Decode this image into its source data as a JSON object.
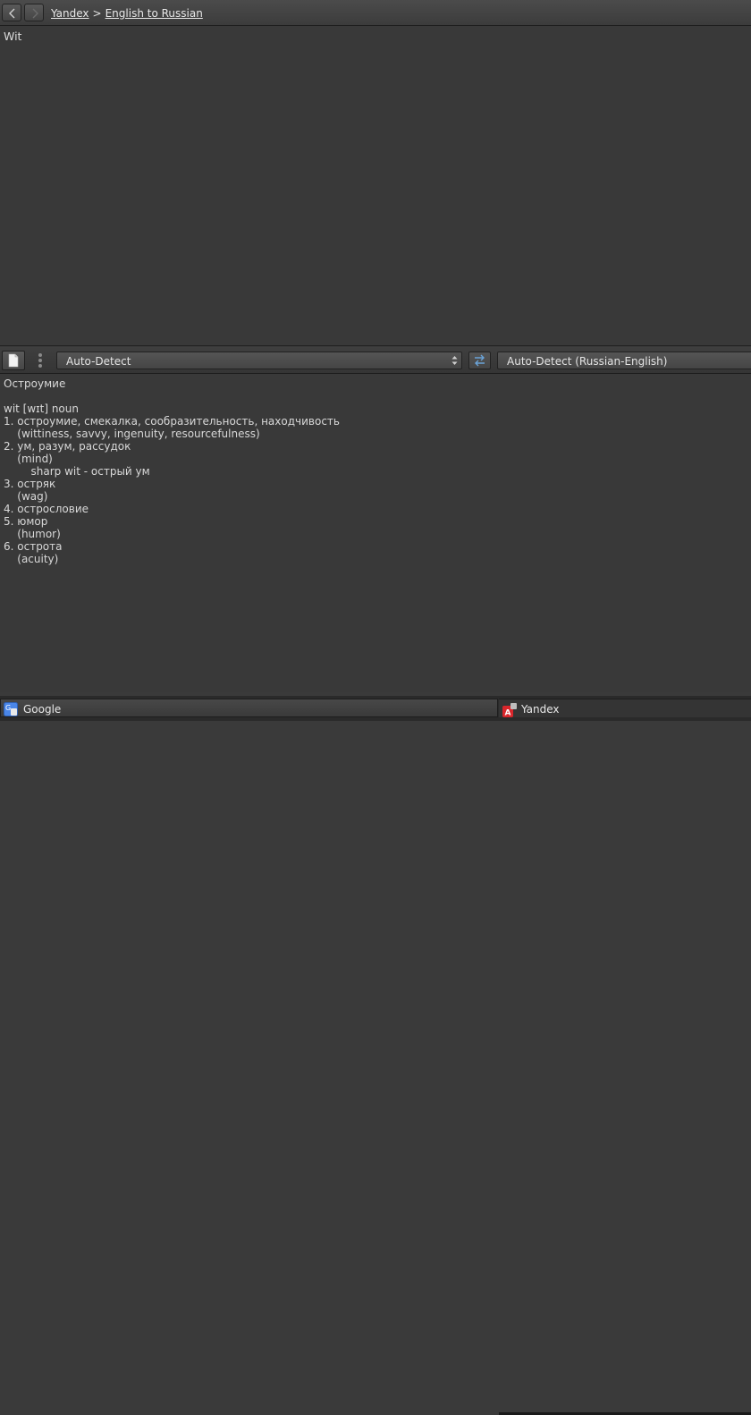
{
  "breadcrumb": {
    "root": "Yandex",
    "separator": ">",
    "current": "English to Russian"
  },
  "input": {
    "text": "Wit"
  },
  "toolbar": {
    "source_language": "Auto-Detect",
    "target_language": "Auto-Detect (Russian-English)"
  },
  "output": {
    "lines": [
      "Остроумие",
      "",
      "wit [wɪt] noun",
      "1. остроумие, смекалка, сообразительность, находчивость",
      "    (wittiness, savvy, ingenuity, resourcefulness)",
      "2. ум, разум, рассудок",
      "    (mind)",
      "        sharp wit - острый ум",
      "3. остряк",
      "    (wag)",
      "4. острословие",
      "5. юмор",
      "    (humor)",
      "6. острота",
      "    (acuity)"
    ]
  },
  "tabs": [
    {
      "label": "Google",
      "icon": "google-translate-icon"
    },
    {
      "label": "Yandex",
      "icon": "yandex-translate-icon"
    }
  ],
  "colors": {
    "background": "#393939",
    "text": "#d8d8d8",
    "swap_accent": "#6aa3d8"
  }
}
